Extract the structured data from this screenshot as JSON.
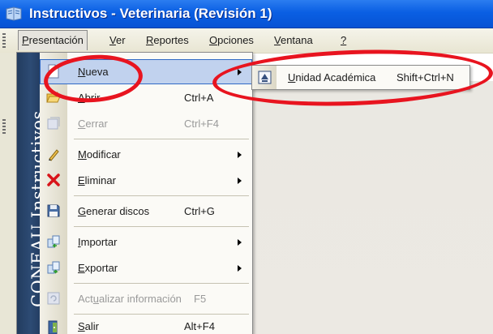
{
  "window": {
    "title": "Instructivos - Veterinaria (Revisión 1)",
    "title_color": "#0a5fe3"
  },
  "menubar": {
    "items": [
      {
        "pre": "",
        "mn": "P",
        "post": "resentación"
      },
      {
        "pre": "",
        "mn": "V",
        "post": "er"
      },
      {
        "pre": "",
        "mn": "R",
        "post": "eportes"
      },
      {
        "pre": "",
        "mn": "O",
        "post": "pciones"
      },
      {
        "pre": "",
        "mn": "V",
        "post": "entana"
      },
      {
        "pre": "",
        "mn": "?",
        "post": ""
      }
    ]
  },
  "banner": {
    "text": "CONEAU  Instructivos",
    "color": "#2d4b74"
  },
  "menu": {
    "items": [
      {
        "icon": "new-document-icon",
        "pre": "",
        "mn": "N",
        "post": "ueva",
        "shortcut": "",
        "submenu": true,
        "disabled": false,
        "highlighted": true
      },
      {
        "icon": "open-folder-icon",
        "pre": "",
        "mn": "A",
        "post": "brir",
        "shortcut": "Ctrl+A",
        "submenu": false,
        "disabled": false
      },
      {
        "icon": "close-document-icon",
        "pre": "",
        "mn": "C",
        "post": "errar",
        "shortcut": "Ctrl+F4",
        "submenu": false,
        "disabled": true
      },
      {
        "icon": "pencil-icon",
        "pre": "",
        "mn": "M",
        "post": "odificar",
        "shortcut": "",
        "submenu": true,
        "disabled": false
      },
      {
        "icon": "delete-x-icon",
        "pre": "",
        "mn": "E",
        "post": "liminar",
        "shortcut": "",
        "submenu": true,
        "disabled": false
      },
      {
        "icon": "floppy-disk-icon",
        "pre": "",
        "mn": "G",
        "post": "enerar discos",
        "shortcut": "Ctrl+G",
        "submenu": false,
        "disabled": false
      },
      {
        "icon": "import-icon",
        "pre": "",
        "mn": "I",
        "post": "mportar",
        "shortcut": "",
        "submenu": true,
        "disabled": false
      },
      {
        "icon": "export-icon",
        "pre": "",
        "mn": "E",
        "post": "xportar",
        "shortcut": "",
        "submenu": true,
        "disabled": false
      },
      {
        "icon": "refresh-icon",
        "pre": "Act",
        "mn": "u",
        "post": "alizar información",
        "shortcut": "F5",
        "submenu": false,
        "disabled": true
      },
      {
        "icon": "exit-door-icon",
        "pre": "",
        "mn": "S",
        "post": "alir",
        "shortcut": "Alt+F4",
        "submenu": false,
        "disabled": false
      }
    ]
  },
  "submenu": {
    "icon": "academic-unit-icon",
    "pre": "",
    "mn": "U",
    "post": "nidad Académica",
    "shortcut": "Shift+Ctrl+N"
  },
  "colors": {
    "highlight": "#c1d2ee",
    "annotation": "#e8141f"
  }
}
